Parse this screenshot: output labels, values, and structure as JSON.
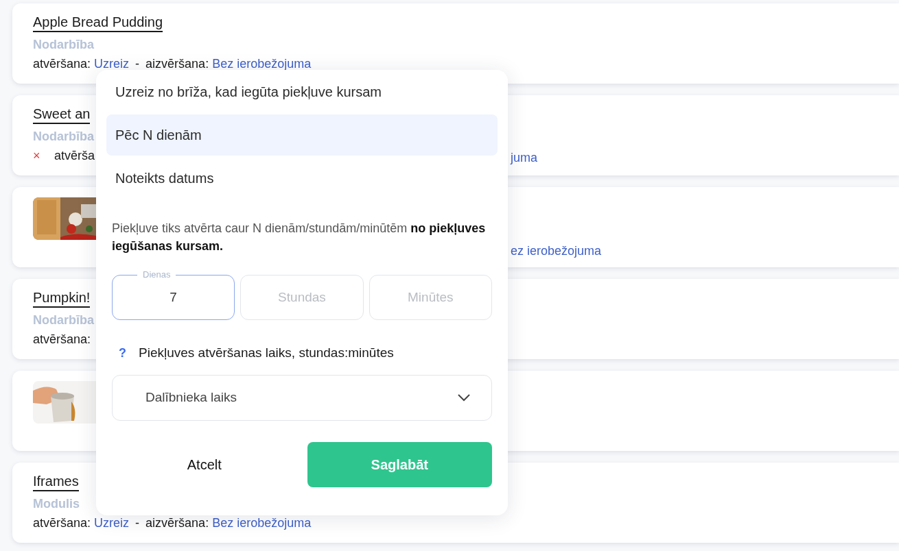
{
  "cards": [
    {
      "title": "Apple Bread Pudding",
      "type": "Nodarbība",
      "line": {
        "kind": "full",
        "opening_label": "atvēršana:",
        "opening_value": "Uzreiz",
        "separator": "-",
        "closing_label": "aizvēršana:",
        "closing_value": "Bez ierobežojuma"
      }
    },
    {
      "title": "Sweet an",
      "type": "Nodarbība",
      "line": {
        "kind": "split",
        "mark": "×",
        "left": "atvērša",
        "right": "juma"
      }
    },
    {
      "image": {
        "kind": "picture"
      },
      "line": {
        "kind": "split",
        "right": "ez ierobežojuma"
      }
    },
    {
      "title": "Pumpkin!",
      "type": "Nodarbība",
      "line": {
        "kind": "split",
        "left": "atvēršana:"
      }
    },
    {
      "image": {
        "kind": "picture"
      }
    },
    {
      "title": "Iframes",
      "type": "Modulis",
      "line": {
        "kind": "full",
        "opening_label": "atvēršana:",
        "opening_value": "Uzreiz",
        "separator": "-",
        "closing_label": "aizvēršana:",
        "closing_value": "Bez ierobežojuma"
      }
    }
  ],
  "popup": {
    "options": [
      {
        "label": "Uzreiz no brīža, kad iegūta piekļuve kursam",
        "selected": false
      },
      {
        "label": "Pēc N dienām",
        "selected": true
      },
      {
        "label": "Noteikts datums",
        "selected": false
      }
    ],
    "description": "Piekļuve tiks atvērta caur N dienām/stundām/minūtēm **no piekļuves iegūšanas kursam.**",
    "fields": [
      {
        "label": "Dienas",
        "value": "7",
        "focused": true
      },
      {
        "placeholder": "Stundas",
        "focused": false
      },
      {
        "placeholder": "Minūtes",
        "focused": false
      }
    ],
    "help": {
      "icon": "?",
      "label": "Piekļuves atvēršanas laiks, stundas:minūtes"
    },
    "select": {
      "value": "Dalībnieka laiks"
    },
    "buttons": {
      "cancel": "Atcelt",
      "save": "Saglabāt"
    }
  }
}
